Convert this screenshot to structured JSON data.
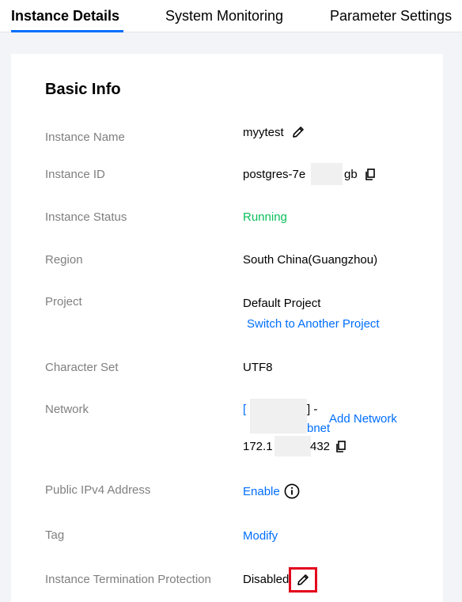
{
  "tabs": [
    {
      "label": "Instance Details",
      "active": true
    },
    {
      "label": "System Monitoring",
      "active": false
    },
    {
      "label": "Parameter Settings",
      "active": false
    }
  ],
  "section_title": "Basic Info",
  "fields": {
    "instance_name": {
      "label": "Instance Name",
      "value": "myytest",
      "icon": "edit-icon"
    },
    "instance_id": {
      "label": "Instance ID",
      "value_prefix": "postgres-7e",
      "value_suffix": "gb",
      "icon": "copy-icon"
    },
    "instance_status": {
      "label": "Instance Status",
      "value": "Running",
      "color": "#0abf5b"
    },
    "region": {
      "label": "Region",
      "value": "South China(Guangzhou)"
    },
    "project": {
      "label": "Project",
      "value": "Default Project",
      "action": "Switch to Another Project"
    },
    "character_set": {
      "label": "Character Set",
      "value": "UTF8"
    },
    "network": {
      "label": "Network",
      "vpc_prefix": "[",
      "vpc_suffix": "] -",
      "subnet_suffix": "bnet",
      "action": "Add Network",
      "ip_prefix": "172.1",
      "ip_suffix": "432",
      "icon": "copy-icon"
    },
    "public_ipv4": {
      "label": "Public IPv4 Address",
      "action": "Enable",
      "icon": "info-icon"
    },
    "tag": {
      "label": "Tag",
      "action": "Modify"
    },
    "termination_protection": {
      "label": "Instance Termination Protection",
      "value": "Disabled",
      "icon": "edit-icon"
    }
  },
  "colors": {
    "accent": "#006eff",
    "success": "#0abf5b",
    "highlight": "#e3001b"
  }
}
